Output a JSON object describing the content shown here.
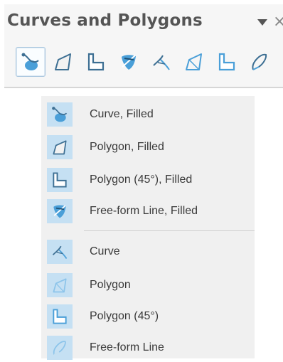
{
  "toolbar": {
    "title": "Curves and Polygons",
    "close_glyph": "×",
    "tools": [
      {
        "name": "curve-filled-tool",
        "icon": "curve-filled-icon",
        "active": true
      },
      {
        "name": "polygon-filled-tool",
        "icon": "polygon-filled-icon"
      },
      {
        "name": "polygon-45-filled-tool",
        "icon": "polygon-45-filled-icon"
      },
      {
        "name": "freeform-filled-tool",
        "icon": "freeform-filled-icon"
      },
      {
        "name": "curve-tool",
        "icon": "curve-icon"
      },
      {
        "name": "polygon-tool",
        "icon": "polygon-icon"
      },
      {
        "name": "polygon-45-tool",
        "icon": "polygon-45-icon"
      },
      {
        "name": "freeform-tool",
        "icon": "freeform-icon"
      }
    ]
  },
  "menu": {
    "items": [
      {
        "label": "Curve, Filled",
        "icon": "curve-filled-icon"
      },
      {
        "label": "Polygon, Filled",
        "icon": "polygon-filled-icon"
      },
      {
        "label": "Polygon (45°), Filled",
        "icon": "polygon-45-filled-icon"
      },
      {
        "label": "Free-form Line, Filled",
        "icon": "freeform-filled-icon"
      },
      {
        "label": "Curve",
        "icon": "curve-icon"
      },
      {
        "label": "Polygon",
        "icon": "polygon-icon"
      },
      {
        "label": "Polygon (45°)",
        "icon": "polygon-45-icon"
      },
      {
        "label": "Free-form Line",
        "icon": "freeform-icon"
      }
    ]
  },
  "colors": {
    "icon_dark": "#3d6f93",
    "icon_blue": "#4a9fd8",
    "icon_fill": "#8cc4ea",
    "menu_bg": "#f0f0f0",
    "menu_icon_bg": "#c5e0f3"
  }
}
